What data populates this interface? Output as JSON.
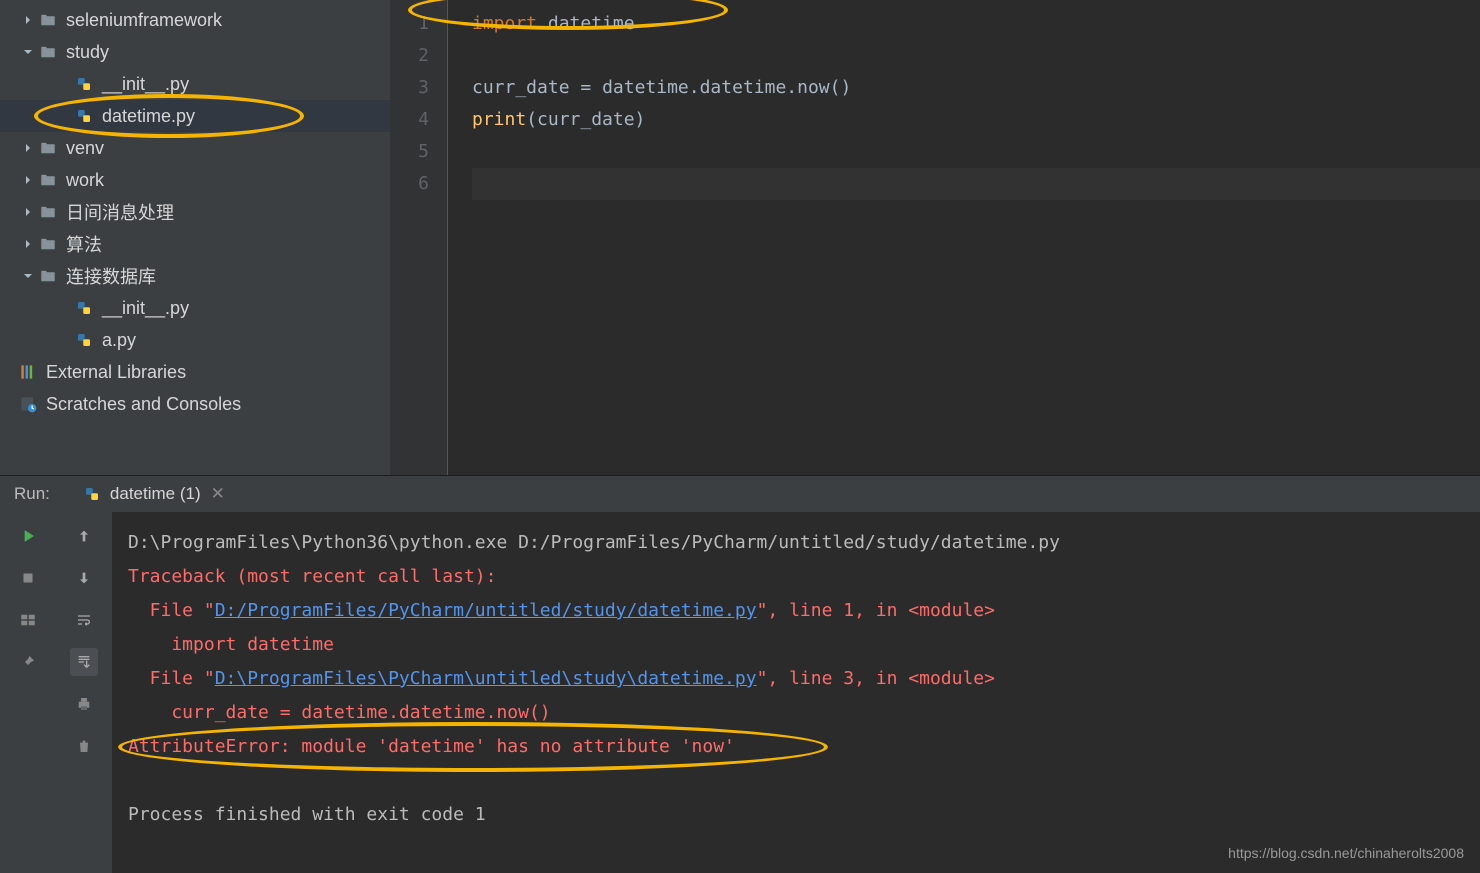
{
  "sidebar": {
    "items": [
      {
        "label": "seleniumframework",
        "type": "folder",
        "indent": 1,
        "arrow": "right"
      },
      {
        "label": "study",
        "type": "folder",
        "indent": 1,
        "arrow": "down"
      },
      {
        "label": "__init__.py",
        "type": "python",
        "indent": 2,
        "arrow": "none"
      },
      {
        "label": "datetime.py",
        "type": "python",
        "indent": 2,
        "arrow": "none",
        "selected": true,
        "highlighted": true
      },
      {
        "label": "venv",
        "type": "folder",
        "indent": 1,
        "arrow": "right"
      },
      {
        "label": "work",
        "type": "folder",
        "indent": 1,
        "arrow": "right"
      },
      {
        "label": "日间消息处理",
        "type": "folder",
        "indent": 1,
        "arrow": "right"
      },
      {
        "label": "算法",
        "type": "folder",
        "indent": 1,
        "arrow": "right"
      },
      {
        "label": "连接数据库",
        "type": "folder",
        "indent": 1,
        "arrow": "down"
      },
      {
        "label": "__init__.py",
        "type": "python",
        "indent": 2,
        "arrow": "none"
      },
      {
        "label": "a.py",
        "type": "python",
        "indent": 2,
        "arrow": "none"
      },
      {
        "label": "External Libraries",
        "type": "lib",
        "indent": 0,
        "arrow": "none"
      },
      {
        "label": "Scratches and Consoles",
        "type": "scratch",
        "indent": 0,
        "arrow": "none"
      }
    ]
  },
  "editor": {
    "line_numbers": [
      "1",
      "2",
      "3",
      "4",
      "5",
      "6"
    ],
    "code": [
      {
        "tokens": [
          {
            "t": "import ",
            "c": "kw"
          },
          {
            "t": "datetime",
            "c": "txt"
          }
        ],
        "highlighted": true
      },
      {
        "tokens": []
      },
      {
        "tokens": [
          {
            "t": "curr_date ",
            "c": "txt"
          },
          {
            "t": "= ",
            "c": "txt"
          },
          {
            "t": "datetime.datetime.now()",
            "c": "txt"
          }
        ]
      },
      {
        "tokens": [
          {
            "t": "print",
            "c": "fn"
          },
          {
            "t": "(curr_date)",
            "c": "txt"
          }
        ]
      },
      {
        "tokens": []
      },
      {
        "tokens": [],
        "current": true
      }
    ]
  },
  "run": {
    "label": "Run:",
    "tab_name": "datetime (1)",
    "console": [
      {
        "segments": [
          {
            "t": "D:\\ProgramFiles\\Python36\\python.exe D:/ProgramFiles/PyCharm/untitled/study/datetime.py",
            "c": ""
          }
        ]
      },
      {
        "segments": [
          {
            "t": "Traceback (most recent call last):",
            "c": "err"
          }
        ]
      },
      {
        "segments": [
          {
            "t": "  File \"",
            "c": "err"
          },
          {
            "t": "D:/ProgramFiles/PyCharm/untitled/study/datetime.py",
            "c": "link"
          },
          {
            "t": "\", line 1, in <module>",
            "c": "err"
          }
        ]
      },
      {
        "segments": [
          {
            "t": "    import datetime",
            "c": "err"
          }
        ]
      },
      {
        "segments": [
          {
            "t": "  File \"",
            "c": "err"
          },
          {
            "t": "D:\\ProgramFiles\\PyCharm\\untitled\\study\\datetime.py",
            "c": "link"
          },
          {
            "t": "\", line 3, in <module>",
            "c": "err"
          }
        ]
      },
      {
        "segments": [
          {
            "t": "    curr_date = datetime.datetime.now()",
            "c": "err"
          }
        ]
      },
      {
        "segments": [
          {
            "t": "AttributeError: module 'datetime' has no attribute 'now'",
            "c": "err"
          }
        ],
        "highlighted": true
      },
      {
        "segments": []
      },
      {
        "segments": [
          {
            "t": "Process finished with exit code 1",
            "c": ""
          }
        ]
      }
    ]
  },
  "watermark": "https://blog.csdn.net/chinaherolts2008"
}
